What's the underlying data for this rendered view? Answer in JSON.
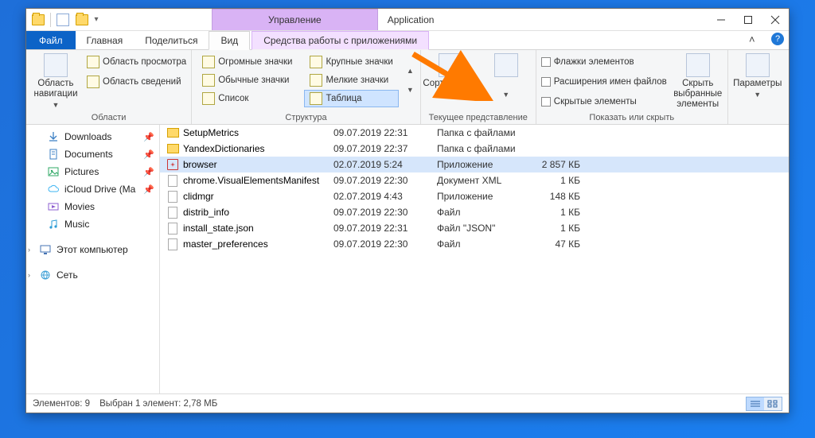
{
  "title": "Application",
  "management_tab": "Управление",
  "tabs": {
    "file": "Файл",
    "home": "Главная",
    "share": "Поделиться",
    "view": "Вид",
    "app_tools": "Средства работы с приложениями"
  },
  "ribbon": {
    "panels": {
      "nav_panel_btn": "Область навигации",
      "preview_area": "Область просмотра",
      "info_area": "Область сведений",
      "areas_label": "Области"
    },
    "views": {
      "huge": "Огромные значки",
      "big": "Крупные значки",
      "normal": "Обычные значки",
      "small": "Мелкие значки",
      "list": "Список",
      "table": "Таблица",
      "struct_label": "Структура"
    },
    "sort_btn": "Сортировать",
    "current_view_label": "Текущее представление",
    "checkboxes": "Флажки элементов",
    "extensions": "Расширения имен файлов",
    "hidden": "Скрытые элементы",
    "hide_selected": "Скрыть выбранные элементы",
    "options": "Параметры",
    "show_hide_label": "Показать или скрыть"
  },
  "nav": {
    "downloads": "Downloads",
    "documents": "Documents",
    "pictures": "Pictures",
    "icloud": "iCloud Drive (Ma",
    "movies": "Movies",
    "music": "Music",
    "this_pc": "Этот компьютер",
    "network": "Сеть"
  },
  "files": [
    {
      "icon": "fold",
      "name": "SetupMetrics",
      "date": "09.07.2019 22:31",
      "type": "Папка с файлами",
      "size": ""
    },
    {
      "icon": "fold",
      "name": "YandexDictionaries",
      "date": "09.07.2019 22:37",
      "type": "Папка с файлами",
      "size": ""
    },
    {
      "icon": "app",
      "name": "browser",
      "date": "02.07.2019 5:24",
      "type": "Приложение",
      "size": "2 857 КБ",
      "sel": true
    },
    {
      "icon": "doc",
      "name": "chrome.VisualElementsManifest",
      "date": "09.07.2019 22:30",
      "type": "Документ XML",
      "size": "1 КБ"
    },
    {
      "icon": "doc",
      "name": "clidmgr",
      "date": "02.07.2019 4:43",
      "type": "Приложение",
      "size": "148 КБ"
    },
    {
      "icon": "doc",
      "name": "distrib_info",
      "date": "09.07.2019 22:30",
      "type": "Файл",
      "size": "1 КБ"
    },
    {
      "icon": "doc",
      "name": "install_state.json",
      "date": "09.07.2019 22:31",
      "type": "Файл \"JSON\"",
      "size": "1 КБ"
    },
    {
      "icon": "doc",
      "name": "master_preferences",
      "date": "09.07.2019 22:30",
      "type": "Файл",
      "size": "47 КБ"
    }
  ],
  "status": {
    "count": "Элементов: 9",
    "selection": "Выбран 1 элемент: 2,78 МБ"
  }
}
